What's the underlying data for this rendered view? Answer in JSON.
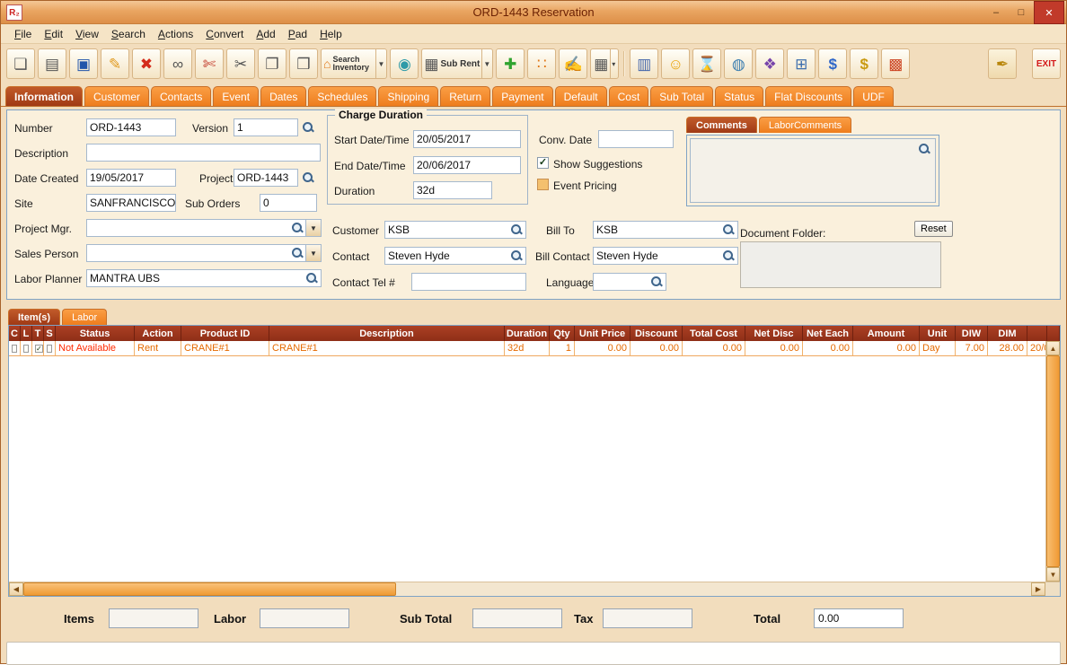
{
  "window": {
    "title": "ORD-1443 Reservation",
    "app_icon_text": "R₂",
    "controls": {
      "minimize": "–",
      "maximize": "□",
      "close": "✕"
    }
  },
  "menu": {
    "items": [
      "File",
      "Edit",
      "View",
      "Search",
      "Actions",
      "Convert",
      "Add",
      "Pad",
      "Help"
    ]
  },
  "icons": {
    "check": "✓",
    "dropdown": "▼",
    "dropdown_small": "▾",
    "scroll_up": "▲",
    "scroll_down": "▼",
    "scroll_left": "◀",
    "scroll_right": "▶"
  },
  "toolbar": {
    "buttons": [
      {
        "name": "new-document",
        "glyph": "❏"
      },
      {
        "name": "print",
        "glyph": "▤"
      },
      {
        "name": "save",
        "glyph": "▣"
      },
      {
        "name": "edit-pencil",
        "glyph": "✎"
      },
      {
        "name": "delete",
        "glyph": "✖"
      },
      {
        "name": "find-binoculars",
        "glyph": "∞"
      },
      {
        "name": "cut-document",
        "glyph": "✄"
      },
      {
        "name": "scissors",
        "glyph": "✂"
      },
      {
        "name": "copy",
        "glyph": "❐"
      },
      {
        "name": "paste",
        "glyph": "❒"
      },
      {
        "name": "search-inventory",
        "glyph": "⌂",
        "label": "Search Inventory"
      },
      {
        "name": "droplet",
        "glyph": "◉"
      },
      {
        "name": "sub-rent",
        "glyph": "▦",
        "label": "Sub Rent"
      },
      {
        "name": "add",
        "glyph": "✚"
      },
      {
        "name": "group",
        "glyph": "∷"
      },
      {
        "name": "edit-note",
        "glyph": "✍"
      },
      {
        "name": "grid",
        "glyph": "▦"
      },
      {
        "name": "report-print",
        "glyph": "▥"
      },
      {
        "name": "smiley",
        "glyph": "☺"
      },
      {
        "name": "time-save",
        "glyph": "⌛"
      },
      {
        "name": "globe-disk",
        "glyph": "◍"
      },
      {
        "name": "books",
        "glyph": "❖"
      },
      {
        "name": "table-edit",
        "glyph": "⊞"
      },
      {
        "name": "dollar-transfer",
        "glyph": "$"
      },
      {
        "name": "money",
        "glyph": "$"
      },
      {
        "name": "cubes",
        "glyph": "▩"
      },
      {
        "name": "wand",
        "glyph": "✒"
      },
      {
        "name": "exit",
        "label": "EXIT"
      }
    ]
  },
  "tabs": {
    "selected": "Information",
    "items": [
      "Information",
      "Customer",
      "Contacts",
      "Event",
      "Dates",
      "Schedules",
      "Shipping",
      "Return",
      "Payment",
      "Default",
      "Cost",
      "Sub Total",
      "Status",
      "Flat Discounts",
      "UDF"
    ]
  },
  "info": {
    "number_label": "Number",
    "number_value": "ORD-1443",
    "version_label": "Version",
    "version_value": "1",
    "description_label": "Description",
    "description_value": "",
    "date_created_label": "Date Created",
    "date_created_value": "19/05/2017",
    "project_label": "Project",
    "project_value": "ORD-1443",
    "site_label": "Site",
    "site_value": "SANFRANCISCO",
    "sub_orders_label": "Sub Orders",
    "sub_orders_value": "0",
    "project_mgr_label": "Project Mgr.",
    "project_mgr_value": "",
    "sales_person_label": "Sales Person",
    "sales_person_value": "",
    "labor_planner_label": "Labor Planner",
    "labor_planner_value": "MANTRA UBS",
    "charge_duration": {
      "legend": "Charge Duration",
      "start_label": "Start Date/Time",
      "start_value": "20/05/2017",
      "end_label": "End Date/Time",
      "end_value": "20/06/2017",
      "duration_label": "Duration",
      "duration_value": "32d"
    },
    "conv_date_label": "Conv. Date",
    "conv_date_value": "",
    "show_suggestions_label": "Show Suggestions",
    "show_suggestions_checked": true,
    "event_pricing_label": "Event Pricing",
    "event_pricing_checked": false,
    "customer_label": "Customer",
    "customer_value": "KSB",
    "bill_to_label": "Bill To",
    "bill_to_value": "KSB",
    "contact_label": "Contact",
    "contact_value": "Steven Hyde",
    "bill_contact_label": "Bill Contact",
    "bill_contact_value": "Steven Hyde",
    "contact_tel_label": "Contact Tel #",
    "contact_tel_value": "",
    "language_label": "Language",
    "language_value": "",
    "comments_tab": "Comments",
    "labor_comments_tab": "LaborComments",
    "comments_value": "",
    "document_folder_label": "Document Folder:",
    "reset_button": "Reset"
  },
  "items_section": {
    "tabs": [
      "Item(s)",
      "Labor"
    ],
    "selected_tab": "Item(s)",
    "table": {
      "columns": [
        "C",
        "L",
        "T",
        "S",
        "Status",
        "Action",
        "Product ID",
        "Description",
        "Duration",
        "Qty",
        "Unit Price",
        "Discount",
        "Total Cost",
        "Net Disc",
        "Net Each",
        "Amount",
        "Unit",
        "DIW",
        "DIM",
        ""
      ],
      "rows": [
        {
          "c": false,
          "l": false,
          "t": true,
          "s": false,
          "status": "Not Available",
          "action": "Rent",
          "product_id": "CRANE#1",
          "description": "CRANE#1",
          "duration": "32d",
          "qty": "1",
          "unit_price": "0.00",
          "discount": "0.00",
          "total_cost": "0.00",
          "net_disc": "0.00",
          "net_each": "0.00",
          "amount": "0.00",
          "unit": "Day",
          "diw": "7.00",
          "dim": "28.00",
          "extra": "20/0"
        }
      ]
    }
  },
  "totals": {
    "items_label": "Items",
    "items_value": "",
    "labor_label": "Labor",
    "labor_value": "",
    "sub_total_label": "Sub Total",
    "sub_total_value": "",
    "tax_label": "Tax",
    "tax_value": "",
    "total_label": "Total",
    "total_value": "0.00"
  },
  "colors": {
    "tab_orange": "#EE7D1D",
    "tab_selected": "#A03A15",
    "table_header": "#9E3520",
    "row_text": "#E56A00",
    "status_unavailable": "#FF2A00",
    "titlebar": "#E9A561",
    "close_button": "#C13A2A",
    "scrollbar_thumb": "#F09A35"
  }
}
